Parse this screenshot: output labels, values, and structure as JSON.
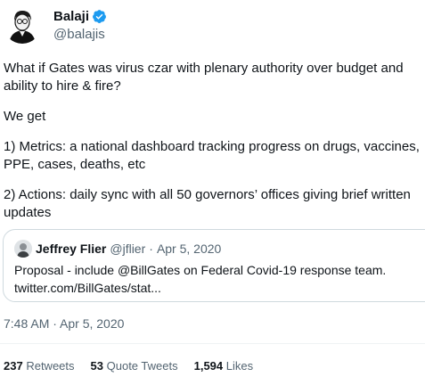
{
  "author": {
    "name": "Balaji",
    "handle": "@balajis"
  },
  "tweet": {
    "lines": [
      "What if Gates was virus czar with plenary authority over budget and",
      "ability to hire & fire?",
      "We get",
      "1) Metrics: a national dashboard tracking progress on drugs, vaccines,",
      "PPE, cases, deaths, etc",
      "2) Actions: daily sync with all 50 governors’ offices giving brief written",
      "updates"
    ]
  },
  "quote": {
    "name": "Jeffrey Flier",
    "handle": "@jflier",
    "separator": "·",
    "date": "Apr 5, 2020",
    "text_line1": "Proposal - include @BillGates on Federal Covid-19 response team.",
    "text_line2": "twitter.com/BillGates/stat..."
  },
  "timestamp": "7:48 AM · Apr 5, 2020",
  "stats": {
    "retweets_count": "237",
    "retweets_label": "Retweets",
    "quotes_count": "53",
    "quotes_label": "Quote Tweets",
    "likes_count": "1,594",
    "likes_label": "Likes"
  },
  "colors": {
    "verified": "#1d9bf0",
    "secondary_text": "#536471",
    "border": "#cfd9de"
  }
}
